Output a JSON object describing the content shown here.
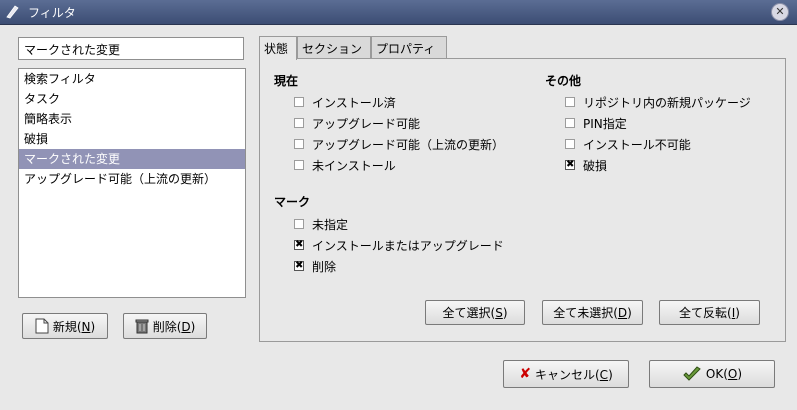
{
  "window": {
    "title": "フィルタ"
  },
  "left": {
    "name_value": "マークされた変更",
    "filters": [
      "検索フィルタ",
      "タスク",
      "簡略表示",
      "破損",
      "マークされた変更",
      "アップグレード可能（上流の更新）"
    ],
    "selected_index": 4,
    "new_button": {
      "label": "新規(",
      "key": "N",
      "suffix": ")"
    },
    "delete_button": {
      "label": "削除(",
      "key": "D",
      "suffix": ")"
    }
  },
  "tabs": [
    "状態",
    "セクション",
    "プロパティ"
  ],
  "status": {
    "current_title": "現在",
    "current": [
      {
        "label": "インストール済",
        "checked": false
      },
      {
        "label": "アップグレード可能",
        "checked": false
      },
      {
        "label": "アップグレード可能（上流の更新）",
        "checked": false
      },
      {
        "label": "未インストール",
        "checked": false
      }
    ],
    "other_title": "その他",
    "other": [
      {
        "label": "リポジトリ内の新規パッケージ",
        "checked": false
      },
      {
        "label": "PIN指定",
        "checked": false
      },
      {
        "label": "インストール不可能",
        "checked": false
      },
      {
        "label": "破損",
        "checked": true
      }
    ],
    "mark_title": "マーク",
    "mark": [
      {
        "label": "未指定",
        "checked": false
      },
      {
        "label": "インストールまたはアップグレード",
        "checked": true
      },
      {
        "label": "削除",
        "checked": true
      }
    ]
  },
  "actions": {
    "select_all": {
      "label": "全て選択(",
      "key": "S",
      "suffix": ")"
    },
    "unselect_all": {
      "label": "全て未選択(",
      "key": "D",
      "suffix": ")"
    },
    "invert": {
      "label": "全て反転(",
      "key": "I",
      "suffix": ")"
    }
  },
  "footer": {
    "cancel": {
      "label": "キャンセル(",
      "key": "C",
      "suffix": ")"
    },
    "ok": {
      "label": "OK(",
      "key": "O",
      "suffix": ")"
    }
  }
}
